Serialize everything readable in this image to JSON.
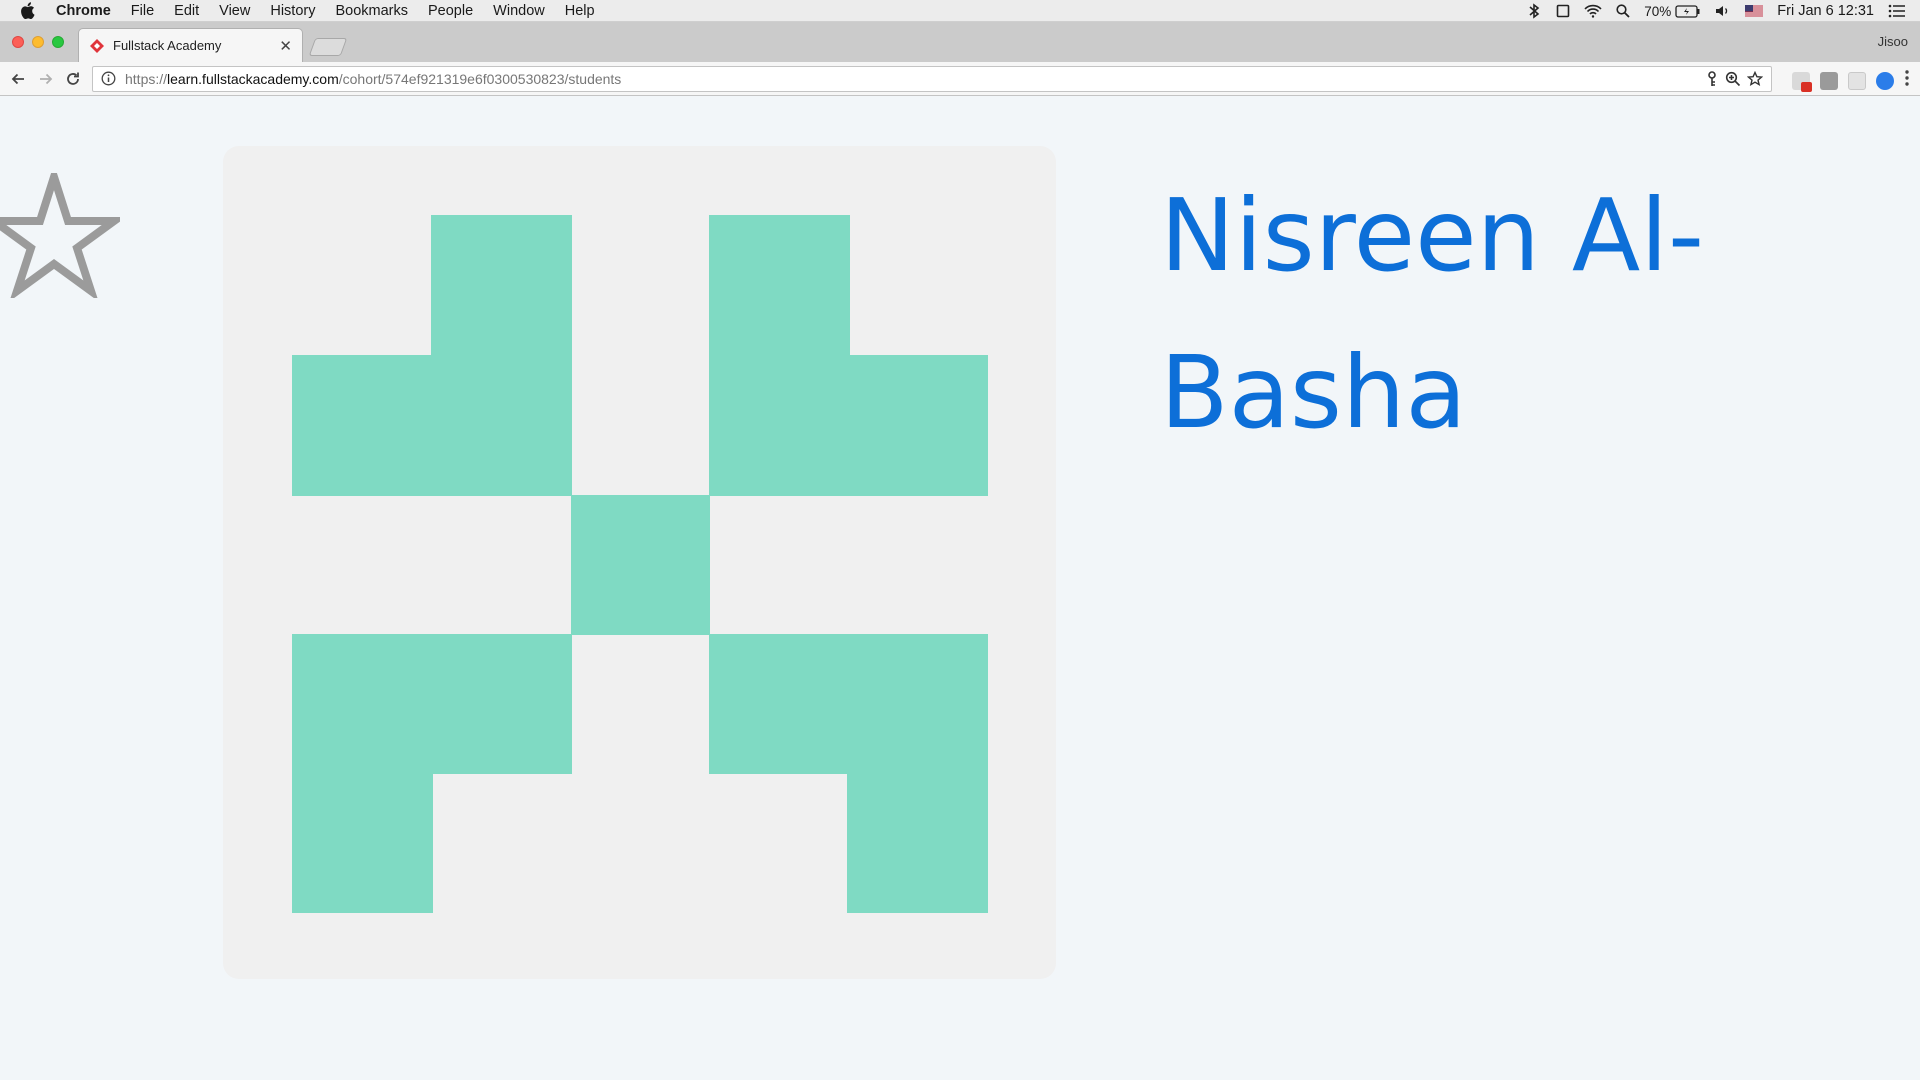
{
  "menubar": {
    "app_name": "Chrome",
    "items": [
      "File",
      "Edit",
      "View",
      "History",
      "Bookmarks",
      "People",
      "Window",
      "Help"
    ],
    "battery": "70%",
    "datetime": "Fri Jan 6  12:31"
  },
  "tabstrip": {
    "tab_title": "Fullstack Academy",
    "profile_name": "Jisoo"
  },
  "toolbar": {
    "url_scheme": "https://",
    "url_host": "learn.fullstackacademy.com",
    "url_path": "/cohort/574ef921319e6f0300530823/students"
  },
  "page": {
    "student_name": "Nisreen Al-Basha",
    "identicon_color": "#7fdac3",
    "card_background": "#f0f0f0",
    "name_color": "#0d6fd8"
  }
}
